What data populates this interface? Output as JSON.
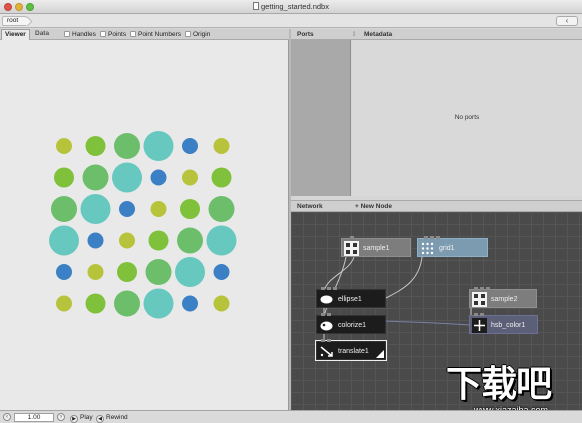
{
  "window": {
    "title": "getting_started.ndbx"
  },
  "address": {
    "crumb": "root",
    "back_symbol": "‹"
  },
  "viewer": {
    "tabs": [
      "Viewer",
      "Data"
    ],
    "options": [
      "Handles",
      "Points",
      "Point Numbers",
      "Origin"
    ]
  },
  "ports_panel": {
    "title": "Ports",
    "metadata_title": "Metadata",
    "empty_text": "No ports"
  },
  "network": {
    "title": "Network",
    "new_node": "+ New Node",
    "nodes": [
      {
        "id": "sample1",
        "label": "sample1",
        "icon": "grid-dots-icon"
      },
      {
        "id": "grid1",
        "label": "grid1",
        "icon": "grid-icon"
      },
      {
        "id": "ellipse1",
        "label": "ellipse1",
        "icon": "ellipse-icon"
      },
      {
        "id": "colorize1",
        "label": "colorize1",
        "icon": "colorize-icon"
      },
      {
        "id": "translate1",
        "label": "translate1",
        "icon": "translate-icon"
      },
      {
        "id": "sample2",
        "label": "sample2",
        "icon": "grid-dots-icon"
      },
      {
        "id": "hsb_color1",
        "label": "hsb_color1",
        "icon": "color-icon"
      }
    ]
  },
  "colors": {
    "yellow_green": "#b8c33c",
    "green": "#7fc13b",
    "mid_green": "#6cbe6b",
    "teal": "#67c8c0",
    "blue": "#3b7fc4",
    "connection": "#c8c8c8"
  },
  "circles": [
    {
      "c": "yellow_green",
      "r": 8
    },
    {
      "c": "green",
      "r": 10
    },
    {
      "c": "mid_green",
      "r": 13
    },
    {
      "c": "teal",
      "r": 15
    },
    {
      "c": "blue",
      "r": 8
    },
    {
      "c": "yellow_green",
      "r": 8
    },
    {
      "c": "green",
      "r": 10
    },
    {
      "c": "mid_green",
      "r": 13
    },
    {
      "c": "teal",
      "r": 15
    },
    {
      "c": "blue",
      "r": 8
    },
    {
      "c": "yellow_green",
      "r": 8
    },
    {
      "c": "green",
      "r": 10
    },
    {
      "c": "mid_green",
      "r": 13
    },
    {
      "c": "teal",
      "r": 15
    },
    {
      "c": "blue",
      "r": 8
    },
    {
      "c": "yellow_green",
      "r": 8
    },
    {
      "c": "green",
      "r": 10
    },
    {
      "c": "mid_green",
      "r": 13
    },
    {
      "c": "teal",
      "r": 15
    },
    {
      "c": "blue",
      "r": 8
    },
    {
      "c": "yellow_green",
      "r": 8
    },
    {
      "c": "green",
      "r": 10
    },
    {
      "c": "mid_green",
      "r": 13
    },
    {
      "c": "teal",
      "r": 15
    },
    {
      "c": "blue",
      "r": 8
    },
    {
      "c": "yellow_green",
      "r": 8
    },
    {
      "c": "green",
      "r": 10
    },
    {
      "c": "mid_green",
      "r": 13
    },
    {
      "c": "teal",
      "r": 15
    },
    {
      "c": "blue",
      "r": 8
    },
    {
      "c": "yellow_green",
      "r": 8
    },
    {
      "c": "green",
      "r": 10
    },
    {
      "c": "mid_green",
      "r": 13
    },
    {
      "c": "teal",
      "r": 15
    },
    {
      "c": "blue",
      "r": 8
    },
    {
      "c": "yellow_green",
      "r": 8
    }
  ],
  "bottom": {
    "frame": "1.00",
    "play": "Play",
    "rewind": "Rewind"
  },
  "watermark": {
    "text": "下载吧",
    "url": "www.xiazaiba.com"
  }
}
